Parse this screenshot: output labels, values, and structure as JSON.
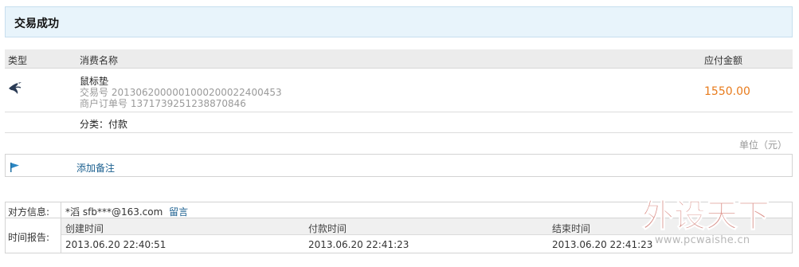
{
  "header": {
    "title": "交易成功"
  },
  "table": {
    "col_type": "类型",
    "col_name": "消费名称",
    "col_amount": "应付金额"
  },
  "item": {
    "name": "鼠标垫",
    "trade_no_label": "交易号",
    "trade_no": "2013062000001000200022400453",
    "order_no_label": "商户订单号",
    "order_no": "1371739251238870846",
    "amount": "1550.00",
    "category": "分类：付款"
  },
  "unit": "单位（元）",
  "memo": {
    "add_label": "添加备注"
  },
  "counterparty": {
    "label": "对方信息:",
    "name": "*滔",
    "account": "sfb***@163.com",
    "message_link": "留言"
  },
  "time_report": {
    "label": "时间报告:",
    "created_label": "创建时间",
    "paid_label": "付款时间",
    "ended_label": "结束时间",
    "created": "2013.06.20 22:40:51",
    "paid": "2013.06.20 22:41:23",
    "ended": "2013.06.20 22:41:23"
  },
  "watermark": {
    "text": "外设天下",
    "url": "www.pcwaishe.cn"
  },
  "colors": {
    "amount": "#e87b1c",
    "link": "#1a5f8f",
    "header_bg": "#e8f4fb",
    "watermark": "#c0392b"
  },
  "icons": {
    "item": "bird-payment-icon",
    "memo": "flag-icon"
  }
}
